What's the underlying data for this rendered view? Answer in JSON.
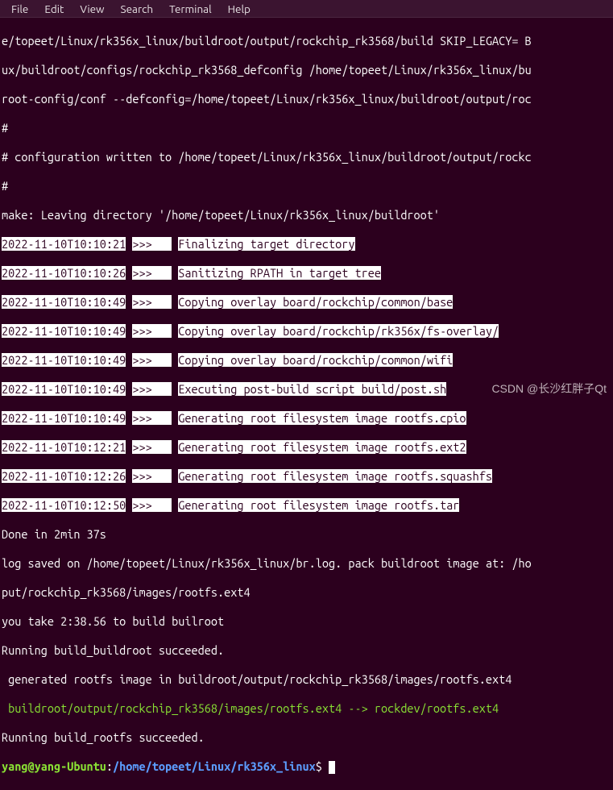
{
  "menu": {
    "items": [
      "File",
      "Edit",
      "View",
      "Search",
      "Terminal",
      "Help"
    ]
  },
  "lines": {
    "l0": "e/topeet/Linux/rk356x_linux/buildroot/output/rockchip_rk3568/build SKIP_LEGACY= B",
    "l1": "ux/buildroot/configs/rockchip_rk3568_defconfig /home/topeet/Linux/rk356x_linux/bu",
    "l2": "root-config/conf --defconfig=/home/topeet/Linux/rk356x_linux/buildroot/output/roc",
    "l3": "#",
    "l4": "# configuration written to /home/topeet/Linux/rk356x_linux/buildroot/output/rockc",
    "l5": "#",
    "l6": "make: Leaving directory '/home/topeet/Linux/rk356x_linux/buildroot'",
    "ts0": "2022-11-10T10:10:21",
    "a0": ">>>   ",
    "m0": "Finalizing target directory",
    "ts1": "2022-11-10T10:10:26",
    "a1": ">>>   ",
    "m1": "Sanitizing RPATH in target tree",
    "ts2": "2022-11-10T10:10:49",
    "a2": ">>>   ",
    "m2": "Copying overlay board/rockchip/common/base",
    "ts3": "2022-11-10T10:10:49",
    "a3": ">>>   ",
    "m3": "Copying overlay board/rockchip/rk356x/fs-overlay/",
    "ts4": "2022-11-10T10:10:49",
    "a4": ">>>   ",
    "m4": "Copying overlay board/rockchip/common/wifi",
    "ts5": "2022-11-10T10:10:49",
    "a5": ">>>   ",
    "m5": "Executing post-build script build/post.sh",
    "ts6": "2022-11-10T10:10:49",
    "a6": ">>>   ",
    "m6": "Generating root filesystem image rootfs.cpio",
    "ts7": "2022-11-10T10:12:21",
    "a7": ">>>   ",
    "m7": "Generating root filesystem image rootfs.ext2",
    "ts8": "2022-11-10T10:12:26",
    "a8": ">>>   ",
    "m8": "Generating root filesystem image rootfs.squashfs",
    "ts9": "2022-11-10T10:12:50",
    "a9": ">>>   ",
    "m9": "Generating root filesystem image rootfs.tar",
    "d0": "Done in 2min 37s",
    "d1": "log saved on /home/topeet/Linux/rk356x_linux/br.log. pack buildroot image at: /ho",
    "d2": "put/rockchip_rk3568/images/rootfs.ext4",
    "d3": "you take 2:38.56 to build builroot",
    "d4": "Running build_buildroot succeeded.",
    "d5": " generated rootfs image in buildroot/output/rockchip_rk3568/images/rootfs.ext4",
    "d6": " buildroot/output/rockchip_rk3568/images/rootfs.ext4 --> rockdev/rootfs.ext4",
    "d7": "Running build_rootfs succeeded."
  },
  "prompt": {
    "user": "yang@yang-Ubuntu",
    "sep": ":",
    "path": "/home/topeet/Linux/rk356x_linux",
    "end": "$ "
  },
  "watermark": "CSDN @长沙红胖子Qt"
}
